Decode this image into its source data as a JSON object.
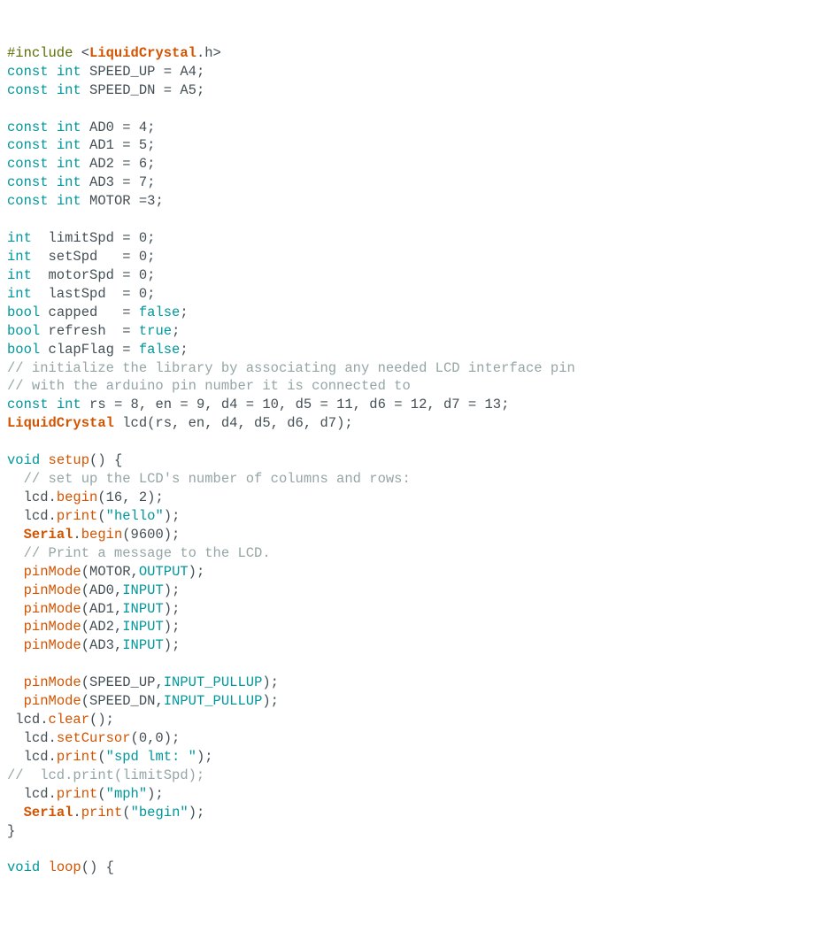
{
  "line1": {
    "pp": "#include",
    "open": " <",
    "lib": "LiquidCrystal",
    "close": ".h>"
  },
  "line2": {
    "kw1": "const",
    "kw2": "int",
    "rest": " SPEED_UP = A4;"
  },
  "line3": {
    "kw1": "const",
    "kw2": "int",
    "rest": " SPEED_DN = A5;"
  },
  "line5": {
    "kw1": "const",
    "kw2": "int",
    "rest": " AD0 = 4;"
  },
  "line6": {
    "kw1": "const",
    "kw2": "int",
    "rest": " AD1 = 5;"
  },
  "line7": {
    "kw1": "const",
    "kw2": "int",
    "rest": " AD2 = 6;"
  },
  "line8": {
    "kw1": "const",
    "kw2": "int",
    "rest": " AD3 = 7;"
  },
  "line9": {
    "kw1": "const",
    "kw2": "int",
    "rest": " MOTOR =3;"
  },
  "line11": {
    "kw": "int",
    "rest": "  limitSpd = 0;"
  },
  "line12": {
    "kw": "int",
    "rest": "  setSpd   = 0;"
  },
  "line13": {
    "kw": "int",
    "rest": "  motorSpd = 0;"
  },
  "line14": {
    "kw": "int",
    "rest": "  lastSpd  = 0;"
  },
  "line15": {
    "kw": "bool",
    "name": " capped   = ",
    "val": "false",
    "semi": ";"
  },
  "line16": {
    "kw": "bool",
    "name": " refresh  = ",
    "val": "true",
    "semi": ";"
  },
  "line17": {
    "kw": "bool",
    "name": " clapFlag = ",
    "val": "false",
    "semi": ";"
  },
  "line18": {
    "cm": "// initialize the library by associating any needed LCD interface pin"
  },
  "line19": {
    "cm": "// with the arduino pin number it is connected to"
  },
  "line20": {
    "kw1": "const",
    "kw2": "int",
    "rest": " rs = 8, en = 9, d4 = 10, d5 = 11, d6 = 12, d7 = 13;"
  },
  "line21": {
    "ty": "LiquidCrystal",
    "rest": " lcd(rs, en, d4, d5, d6, d7);"
  },
  "line23": {
    "kw": "void",
    "fn": "setup",
    "rest": "() {"
  },
  "line24": {
    "cm": "  // set up the LCD's number of columns and rows:"
  },
  "line25": {
    "obj": "  lcd.",
    "fn": "begin",
    "rest": "(16, 2);"
  },
  "line26": {
    "obj": "  lcd.",
    "fn": "print",
    "open": "(",
    "str": "\"hello\"",
    "close": ");"
  },
  "line27": {
    "pre": "  ",
    "ty": "Serial",
    "dot": ".",
    "fn": "begin",
    "rest": "(9600);"
  },
  "line28": {
    "cm": "  // Print a message to the LCD."
  },
  "line29": {
    "pre": "  ",
    "fn": "pinMode",
    "open": "(MOTOR,",
    "cn": "OUTPUT",
    "close": ");"
  },
  "line30": {
    "pre": "  ",
    "fn": "pinMode",
    "open": "(AD0,",
    "cn": "INPUT",
    "close": ");"
  },
  "line31": {
    "pre": "  ",
    "fn": "pinMode",
    "open": "(AD1,",
    "cn": "INPUT",
    "close": ");"
  },
  "line32": {
    "pre": "  ",
    "fn": "pinMode",
    "open": "(AD2,",
    "cn": "INPUT",
    "close": ");"
  },
  "line33": {
    "pre": "  ",
    "fn": "pinMode",
    "open": "(AD3,",
    "cn": "INPUT",
    "close": ");"
  },
  "line35": {
    "pre": "  ",
    "fn": "pinMode",
    "open": "(SPEED_UP,",
    "cn": "INPUT_PULLUP",
    "close": ");"
  },
  "line36": {
    "pre": "  ",
    "fn": "pinMode",
    "open": "(SPEED_DN,",
    "cn": "INPUT_PULLUP",
    "close": ");"
  },
  "line37": {
    "obj": " lcd.",
    "fn": "clear",
    "rest": "();"
  },
  "line38": {
    "obj": "  lcd.",
    "fn": "setCursor",
    "rest": "(0,0);"
  },
  "line39": {
    "obj": "  lcd.",
    "fn": "print",
    "open": "(",
    "str": "\"spd lmt: \"",
    "close": ");"
  },
  "line40": {
    "cm": "//  lcd.print(limitSpd);"
  },
  "line41": {
    "obj": "  lcd.",
    "fn": "print",
    "open": "(",
    "str": "\"mph\"",
    "close": ");"
  },
  "line42": {
    "pre": "  ",
    "ty": "Serial",
    "dot": ".",
    "fn": "print",
    "open": "(",
    "str": "\"begin\"",
    "close": ");"
  },
  "line43": {
    "txt": "}"
  },
  "line45": {
    "kw": "void",
    "fn": "loop",
    "rest": "() {"
  }
}
